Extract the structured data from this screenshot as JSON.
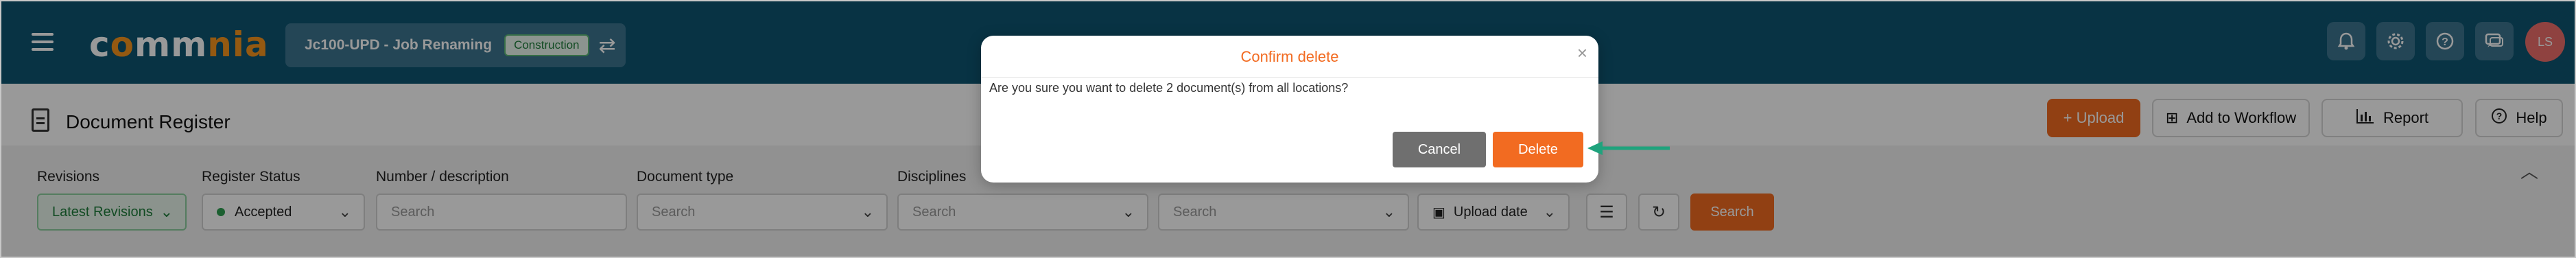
{
  "app": {
    "logo_text_1": "c",
    "logo_text_2": "mm",
    "logo_text_3": "nia",
    "project_name": "Jc100-UPD - Job Renaming",
    "project_badge": "Construction",
    "avatar_initials": "LS"
  },
  "top_icons": [
    "bell-icon",
    "gear-icon",
    "help-circle-icon",
    "chat-icon"
  ],
  "page": {
    "title": "Document Register",
    "upload_label": "+ Upload",
    "workflow_label": "Add to Workflow",
    "report_label": "Report",
    "help_label": "Help"
  },
  "filters": {
    "revisions_label": "Revisions",
    "revisions_value": "Latest Revisions",
    "register_status_label": "Register Status",
    "register_status_value": "Accepted",
    "number_label": "Number / description",
    "number_placeholder": "Search",
    "doc_type_label": "Document type",
    "doc_type_placeholder": "Search",
    "disciplines_label": "Disciplines",
    "disciplines_placeholder": "Search",
    "sixth_placeholder": "Search",
    "sort_value": "Upload date",
    "search_label": "Search"
  },
  "modal": {
    "title": "Confirm delete",
    "message": "Are you sure you want to delete 2 document(s) from all locations?",
    "cancel_label": "Cancel",
    "delete_label": "Delete"
  },
  "colors": {
    "topbar": "#0e5672",
    "accent": "#f26b21",
    "arrow": "#1fa37d"
  }
}
